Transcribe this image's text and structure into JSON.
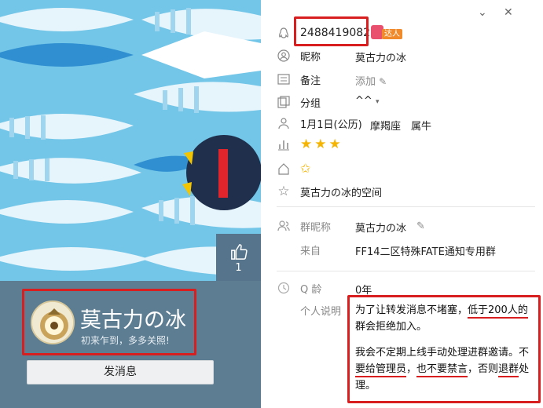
{
  "left": {
    "like_count": "1",
    "nickname": "莫古力の冰",
    "greeting": "初来乍到，多多关照!",
    "send_button": "发消息"
  },
  "right": {
    "qq_number": "2488419082",
    "badge": "达人",
    "fields": {
      "nickname_label": "昵称",
      "nickname_value": "莫古力の冰",
      "remark_label": "备注",
      "remark_value": "添加",
      "group_label": "分组",
      "group_value": "^^",
      "birthday": "1月1日(公历)",
      "zodiac": "摩羯座",
      "chinese_zodiac": "属牛",
      "qzone": "莫古力の冰的空间",
      "group_nick_label": "群昵称",
      "group_nick_value": "莫古力の冰",
      "from_label": "来自",
      "from_value": "FF14二区特殊FATE通知专用群",
      "age_label": "Q 龄",
      "age_value": "0年",
      "intro_label": "个人说明"
    },
    "intro": {
      "p1_a": "为了让转发消息不堵塞，",
      "p1_u": "低于200人的",
      "p1_b": "群会拒绝加入。",
      "p2_a": "我会不定期上线手动处理进群邀请。不",
      "p2_u1": "要给管理员",
      "p2_b": "，",
      "p2_u2": "也不要禁言",
      "p2_c": "，否则",
      "p2_u3": "退群",
      "p2_d": "处",
      "p2_e": "理。"
    }
  },
  "colors": {
    "annotation": "#d81e1e",
    "star": "#f5b400",
    "band": "#5d7d93"
  }
}
